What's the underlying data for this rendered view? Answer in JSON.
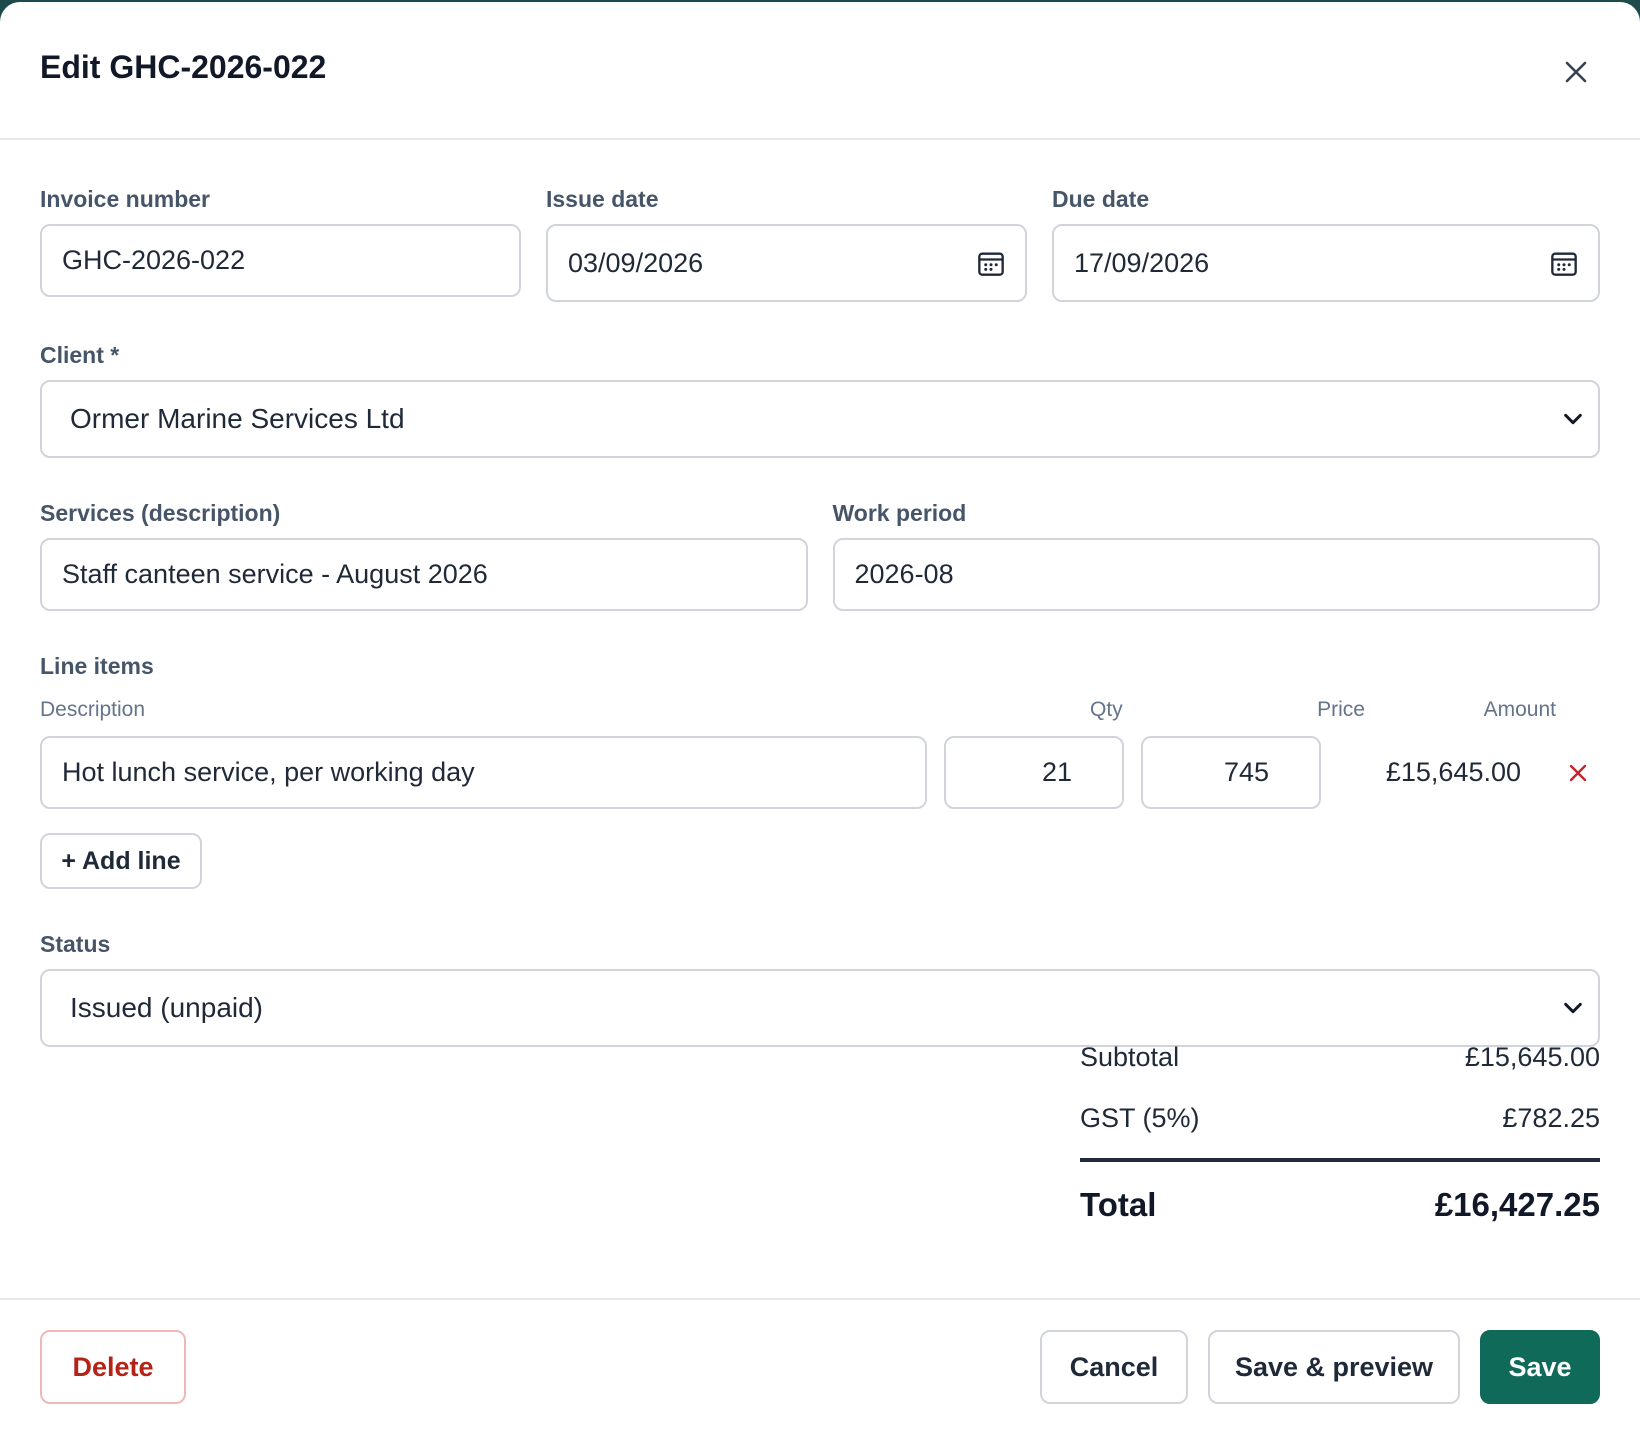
{
  "modal": {
    "title": "Edit GHC-2026-022",
    "close_icon": "close-icon"
  },
  "fields": {
    "invoice_number": {
      "label": "Invoice number",
      "value": "GHC-2026-022"
    },
    "issue_date": {
      "label": "Issue date",
      "value": "03/09/2026"
    },
    "due_date": {
      "label": "Due date",
      "value": "17/09/2026"
    },
    "client": {
      "label": "Client *",
      "value": "Ormer Marine Services Ltd"
    },
    "services": {
      "label": "Services (description)",
      "value": "Staff canteen service - August 2026"
    },
    "work_period": {
      "label": "Work period",
      "value": "2026-08"
    },
    "status": {
      "label": "Status",
      "value": "Issued (unpaid)"
    }
  },
  "line_items": {
    "label": "Line items",
    "headers": {
      "description": "Description",
      "qty": "Qty",
      "price": "Price",
      "amount": "Amount"
    },
    "rows": [
      {
        "description": "Hot lunch service, per working day",
        "qty": "21",
        "price": "745",
        "amount": "£15,645.00"
      }
    ],
    "add_label": "+ Add line"
  },
  "totals": {
    "subtotal_label": "Subtotal",
    "subtotal": "£15,645.00",
    "gst_label": "GST (5%)",
    "gst": "£782.25",
    "total_label": "Total",
    "total": "£16,427.25"
  },
  "footer": {
    "delete": "Delete",
    "cancel": "Cancel",
    "save_preview": "Save & preview",
    "save": "Save"
  },
  "colors": {
    "primary": "#0f6a5a",
    "danger": "#b42318",
    "backdrop": "#1d4a4a"
  }
}
